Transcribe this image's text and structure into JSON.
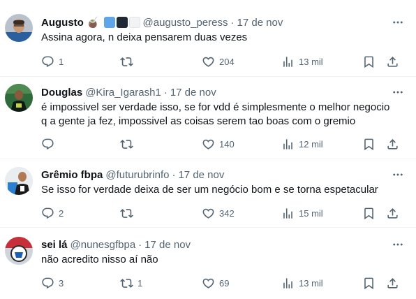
{
  "tweets": [
    {
      "name": "Augusto",
      "emoji": "🧉",
      "handle": "@augusto_peress",
      "time": "17 de nov",
      "text": "Assina agora, n deixa pensarem duas vezes",
      "replies": "1",
      "retweets": "",
      "likes": "204",
      "views": "13 mil"
    },
    {
      "name": "Douglas",
      "handle": "@Kira_Igarash1",
      "time": "17 de nov",
      "text_lines": [
        "é impossivel ser verdade isso, se for vdd é simplesmente o melhor negocio",
        "q a gente ja fez, impossivel as coisas serem tao boas com o gremio"
      ],
      "replies": "",
      "retweets": "",
      "likes": "140",
      "views": "12 mil"
    },
    {
      "name": "Grêmio fbpa",
      "handle": "@futurubrinfo",
      "time": "17 de nov",
      "text": "Se isso for verdade deixa de ser um negócio bom e se torna espetacular",
      "replies": "2",
      "retweets": "",
      "likes": "342",
      "views": "15 mil"
    },
    {
      "name": "sei lá",
      "handle": "@nunesgfbpa",
      "time": "17 de nov",
      "text": "não acredito nisso aí não",
      "replies": "3",
      "retweets": "1",
      "likes": "69",
      "views": "13 mil"
    }
  ],
  "colors": {
    "text": "#0f1419",
    "secondary": "#536471",
    "divider": "#eff3f4",
    "badge_blue": "#5ea6e6",
    "badge_dark": "#1f2a36"
  },
  "icons": [
    "more-icon",
    "reply-icon",
    "retweet-icon",
    "like-icon",
    "views-icon",
    "bookmark-icon",
    "share-icon"
  ]
}
